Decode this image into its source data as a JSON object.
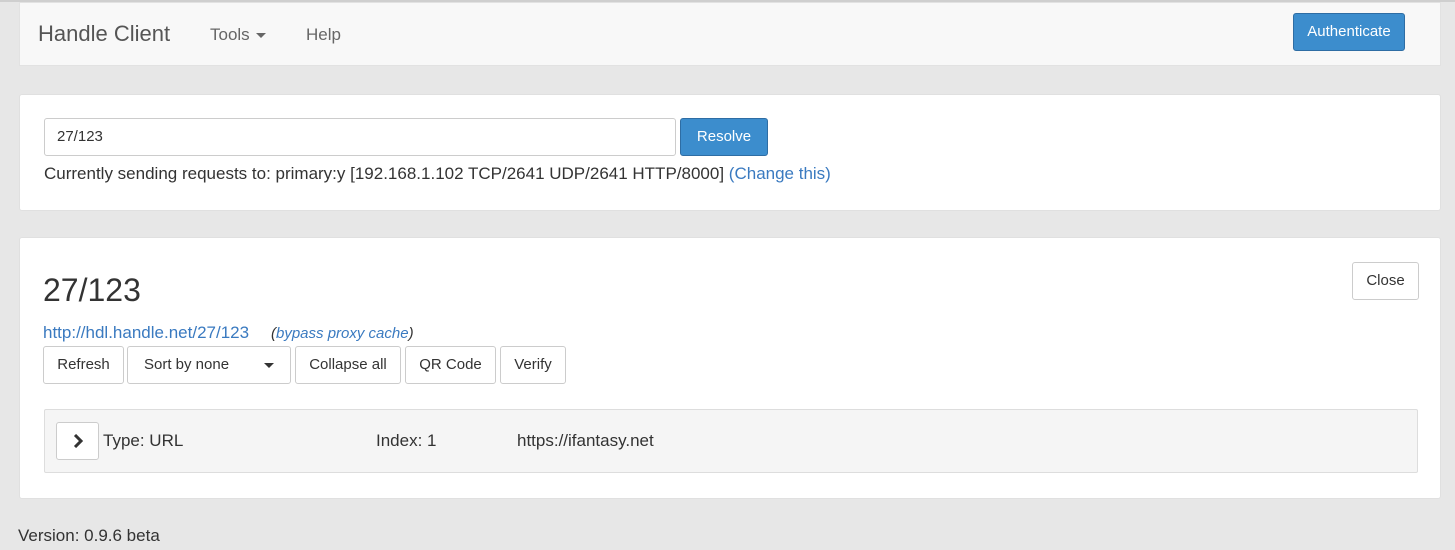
{
  "navbar": {
    "brand": "Handle Client",
    "tools_label": "Tools",
    "help_label": "Help",
    "authenticate_label": "Authenticate"
  },
  "resolver": {
    "input_value": "27/123",
    "resolve_label": "Resolve",
    "status_text": "Currently sending requests to: primary:y [192.168.1.102 TCP/2641 UDP/2641 HTTP/8000]",
    "change_link": "(Change this)"
  },
  "handle_panel": {
    "title": "27/123",
    "close_label": "Close",
    "url": "http://hdl.handle.net/27/123",
    "bypass_open": "(",
    "bypass_link": "bypass proxy cache",
    "bypass_close": ")",
    "toolbar": {
      "refresh": "Refresh",
      "sort": "Sort by none",
      "collapse": "Collapse all",
      "qr": "QR Code",
      "verify": "Verify"
    },
    "values": [
      {
        "type": "Type: URL",
        "index": "Index: 1",
        "data": "https://ifantasy.net"
      }
    ]
  },
  "footer": {
    "version": "Version: 0.9.6 beta"
  },
  "colors": {
    "primary": "#3c8dcd",
    "link": "#3a7ac0",
    "background": "#e7e7e7"
  }
}
